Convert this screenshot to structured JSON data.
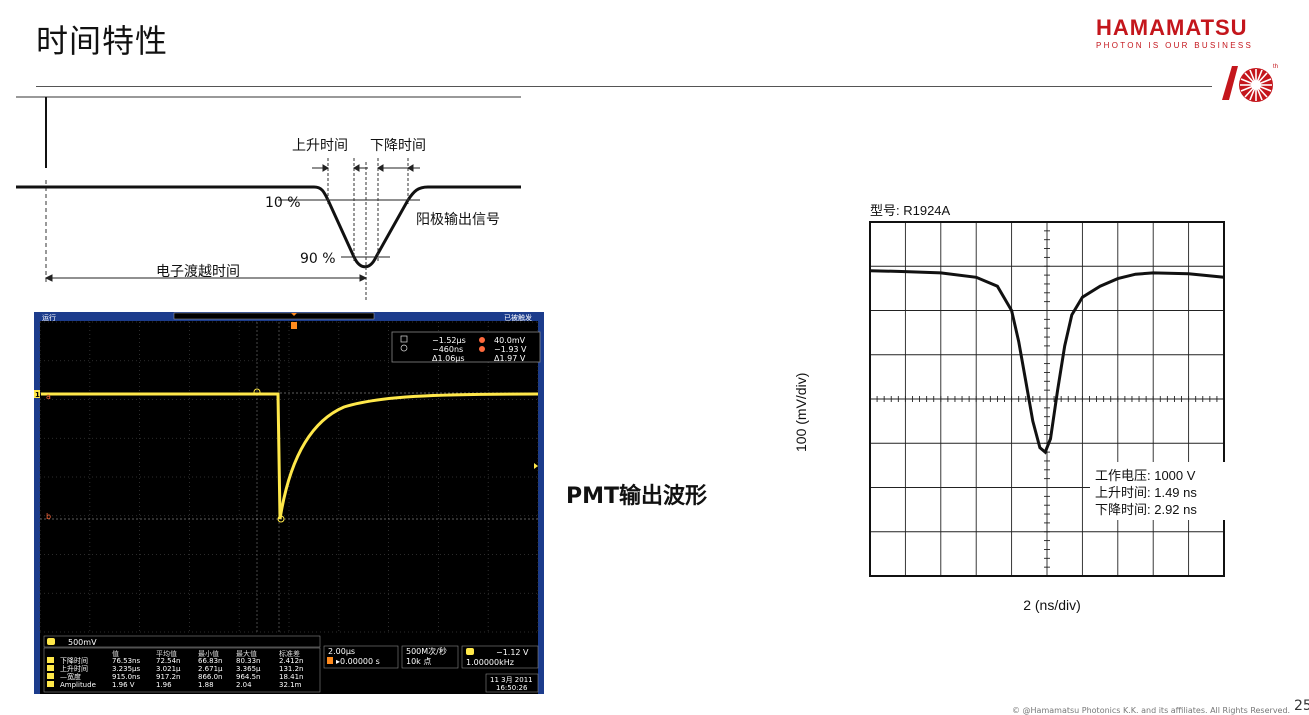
{
  "slide": {
    "title": "时间特性",
    "copyright": "© @Hamamatsu Photonics K.K. and its affiliates. All Rights Reserved.",
    "page_number": "25"
  },
  "logo": {
    "brand": "HAMAMATSU",
    "tagline": "PHOTON IS OUR BUSINESS"
  },
  "diagram": {
    "rise_label": "上升时间",
    "fall_label": "下降时间",
    "level_10": "10 %",
    "level_90": "90 %",
    "anode_label": "阳极输出信号",
    "transit_label": "电子渡越时间"
  },
  "oscilloscope": {
    "top_left": "运行",
    "top_right": "已被触发",
    "cursor_a_time": "−1.52µs",
    "cursor_a_volt": "40.0mV",
    "cursor_b_time": "−460ns",
    "cursor_b_volt": "−1.93 V",
    "delta_time": "Δ1.06µs",
    "delta_volt": "Δ1.97 V",
    "ch1_scale": "500mV",
    "meas_headers": [
      "值",
      "平均值",
      "最小值",
      "最大值",
      "标准差"
    ],
    "measurements": [
      {
        "name": "下降时间",
        "values": [
          "76.53ns",
          "72.54n",
          "66.83n",
          "80.33n",
          "2.412n"
        ]
      },
      {
        "name": "上升时间",
        "values": [
          "3.235µs",
          "3.021µ",
          "2.671µ",
          "3.365µ",
          "131.2n"
        ]
      },
      {
        "name": "—宽度",
        "values": [
          "915.0ns",
          "917.2n",
          "866.0n",
          "964.5n",
          "18.41n"
        ]
      },
      {
        "name": "Amplitude",
        "values": [
          "1.96 V",
          "1.96",
          "1.88",
          "2.04",
          "32.1m"
        ]
      }
    ],
    "timebase": "2.00µs",
    "trigger_pos": "▸0.00000 s",
    "sample_rate": "500M次/秒",
    "record_length": "10k 点",
    "trigger_level": "−1.12 V",
    "trigger_freq": "1.00000kHz",
    "date": "11 3月 2011",
    "time": "16:50:26",
    "colors": {
      "trace": "#ffe84a",
      "panel": "#1c3c8c"
    }
  },
  "pmt_label": "PMT输出波形",
  "right_chart": {
    "model": "型号: R1924A",
    "ylabel": "100 (mV/div)",
    "xlabel": "2 (ns/div)",
    "voltage": "工作电压: 1000 V",
    "rise": "上升时间: 1.49 ns",
    "fall": "下降时间: 2.92 ns"
  },
  "chart_data": {
    "type": "line",
    "title": "型号: R1924A",
    "xlabel": "2 (ns/div)",
    "ylabel": "100 (mV/div)",
    "grid": true,
    "x_divisions": 10,
    "y_divisions": 8,
    "series": [
      {
        "x": [
          0,
          1,
          2,
          3,
          3.6,
          4.0,
          4.2,
          4.4,
          4.6,
          4.8,
          4.95,
          5.1,
          5.3,
          5.5,
          5.7,
          6.0,
          6.5,
          7.0,
          7.5,
          8.0,
          9.0,
          10.0
        ],
        "y": [
          2.9,
          2.88,
          2.85,
          2.75,
          2.55,
          2.0,
          1.3,
          0.4,
          -0.5,
          -1.1,
          -1.2,
          -0.9,
          0.2,
          1.2,
          1.9,
          2.3,
          2.55,
          2.72,
          2.82,
          2.85,
          2.83,
          2.75
        ]
      }
    ]
  }
}
